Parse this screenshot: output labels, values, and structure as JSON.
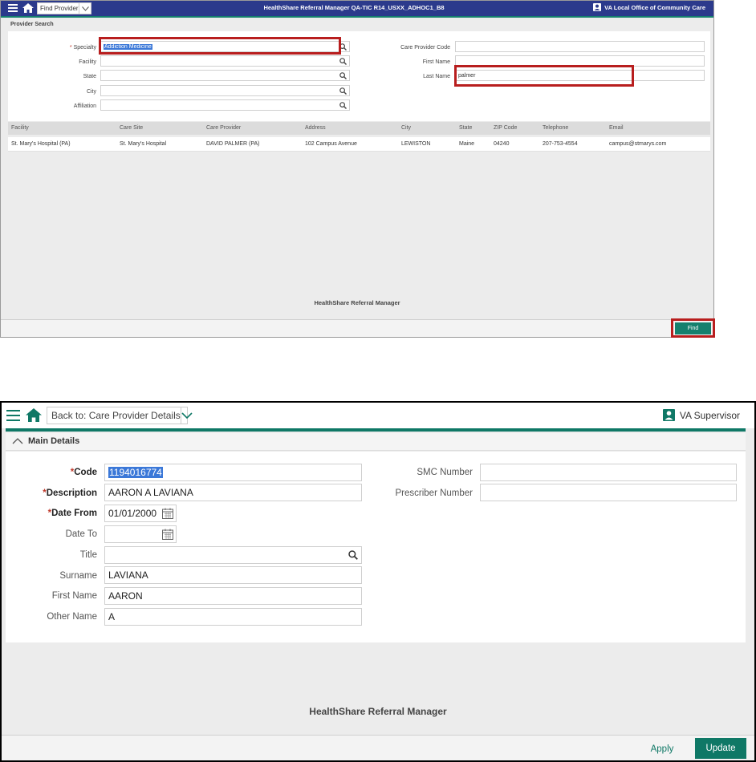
{
  "screen1": {
    "app_title": "HealthShare Referral Manager QA-TIC R14_USXX_ADHOC1_B8",
    "nav_combo": "Find Provider",
    "user": "VA Local Office of Community Care",
    "panel_title": "Provider Search",
    "fields_left": [
      {
        "label": "Specialty",
        "required": true,
        "value": "Addiction Medicine"
      },
      {
        "label": "Facility",
        "required": false,
        "value": ""
      },
      {
        "label": "State",
        "required": false,
        "value": ""
      },
      {
        "label": "City",
        "required": false,
        "value": ""
      },
      {
        "label": "Affiliation",
        "required": false,
        "value": ""
      }
    ],
    "fields_right": [
      {
        "label": "Care Provider Code",
        "value": ""
      },
      {
        "label": "First Name",
        "value": ""
      },
      {
        "label": "Last Name",
        "value": "palmer"
      }
    ],
    "table": {
      "columns": [
        "Facility",
        "Care Site",
        "Care Provider",
        "Address",
        "City",
        "State",
        "ZIP Code",
        "Telephone",
        "Email"
      ],
      "rows": [
        [
          "St. Mary's Hospital (PA)",
          "St. Mary's Hospital",
          "DAVID PALMER (PA)",
          "102 Campus Avenue",
          "LEWISTON",
          "Maine",
          "04240",
          "207-753-4554",
          "campus@stmarys.com"
        ]
      ]
    },
    "footer_brand": "HealthShare Referral Manager",
    "find_button": "Find",
    "colors": {
      "topbar": "#2b3a8c",
      "accent": "#15806e",
      "highlight": "#b81e1e"
    }
  },
  "screen2": {
    "nav_combo": "Back to: Care Provider Details",
    "user": "VA Supervisor",
    "section_title": "Main Details",
    "fields_left": [
      {
        "label": "Code",
        "required": true,
        "value": "1194016774"
      },
      {
        "label": "Description",
        "required": true,
        "value": "AARON A LAVIANA"
      },
      {
        "label": "Date From",
        "required": true,
        "value": "01/01/2000"
      },
      {
        "label": "Date To",
        "required": false,
        "value": ""
      },
      {
        "label": "Title",
        "required": false,
        "value": ""
      },
      {
        "label": "Surname",
        "required": false,
        "value": "LAVIANA"
      },
      {
        "label": "First Name",
        "required": false,
        "value": "AARON"
      },
      {
        "label": "Other Name",
        "required": false,
        "value": "A"
      }
    ],
    "fields_right": [
      {
        "label": "SMC Number",
        "value": ""
      },
      {
        "label": "Prescriber Number",
        "value": ""
      }
    ],
    "footer_brand": "HealthShare Referral Manager",
    "apply_button": "Apply",
    "update_button": "Update",
    "colors": {
      "accent": "#0f7866"
    }
  }
}
